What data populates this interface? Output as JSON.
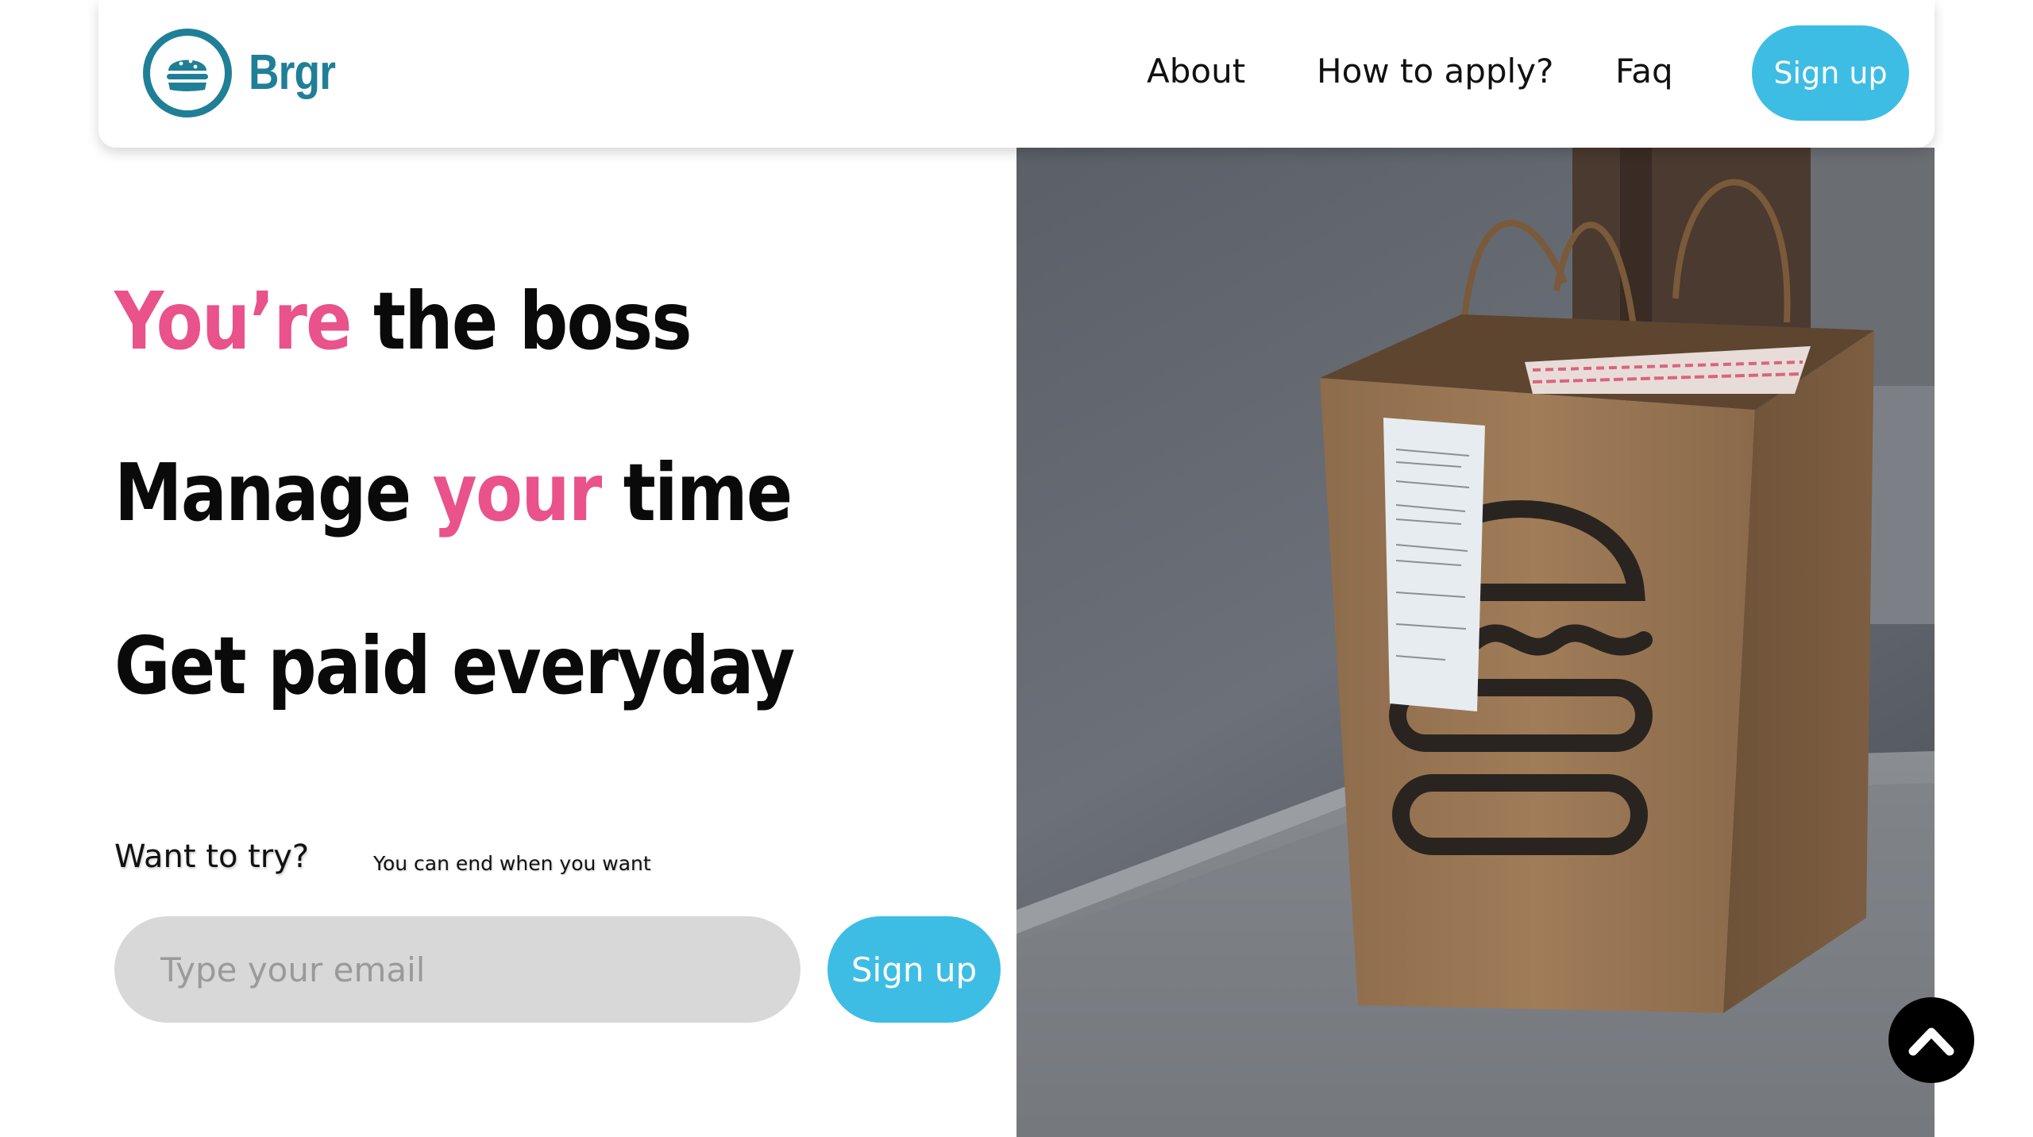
{
  "brand": {
    "name": "Brgr",
    "logo_icon": "burger-icon",
    "color": "#1f7f97"
  },
  "nav": {
    "about": "About",
    "how_to_apply": "How to apply?",
    "faq": "Faq",
    "signup": "Sign up"
  },
  "hero": {
    "line1": {
      "accent": "You’re",
      "rest": " the boss"
    },
    "line2": {
      "start": "Manage ",
      "accent": "your",
      "end": " time"
    },
    "line3": "Get paid everyday",
    "accent_color": "#e9528a"
  },
  "form": {
    "label": "Want to try?",
    "note": "You can end when you want",
    "email_placeholder": "Type your email",
    "signup": "Sign up",
    "button_color": "#3ebde4"
  },
  "scroll_top_icon": "chevron-up-icon"
}
